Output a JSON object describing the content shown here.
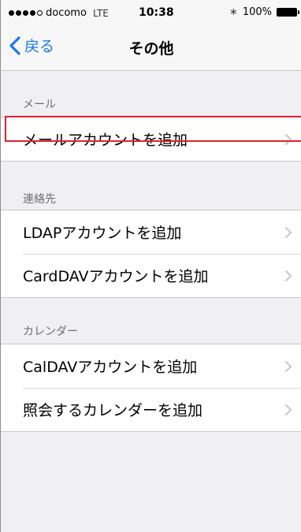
{
  "status_bar": {
    "carrier": "docomo",
    "network": "LTE",
    "time": "10:38",
    "battery": "100%"
  },
  "nav": {
    "back_label": "戻る",
    "title": "その他"
  },
  "sections": [
    {
      "header": "メール",
      "items": [
        {
          "label": "メールアカウントを追加"
        }
      ]
    },
    {
      "header": "連絡先",
      "items": [
        {
          "label": "LDAPアカウントを追加"
        },
        {
          "label": "CardDAVアカウントを追加"
        }
      ]
    },
    {
      "header": "カレンダー",
      "items": [
        {
          "label": "CalDAVアカウントを追加"
        },
        {
          "label": "照会するカレンダーを追加"
        }
      ]
    }
  ],
  "colors": {
    "accent": "#1a78f2",
    "highlight_border": "#e0232b",
    "background": "#efeff4"
  }
}
